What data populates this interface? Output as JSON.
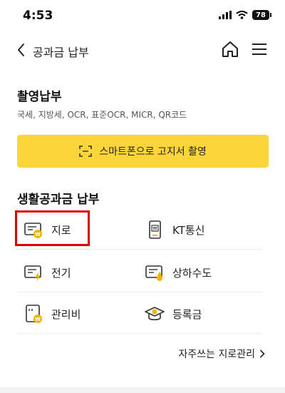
{
  "status": {
    "time": "4:53",
    "battery": "78"
  },
  "header": {
    "title": "공과금 납부"
  },
  "capture": {
    "title": "촬영납부",
    "subtitle": "국세, 지방세, OCR, 표준OCR, MICR, QR코드",
    "button_label": "스마트폰으로 고지서 촬영"
  },
  "living": {
    "title": "생활공과금 납부",
    "items": [
      {
        "label": "지로",
        "icon": "giro-bill-icon"
      },
      {
        "label": "KT통신",
        "icon": "kt-phone-icon"
      },
      {
        "label": "전기",
        "icon": "electricity-bill-icon"
      },
      {
        "label": "상하수도",
        "icon": "water-bill-icon"
      },
      {
        "label": "관리비",
        "icon": "maintenance-fee-icon"
      },
      {
        "label": "등록금",
        "icon": "tuition-icon"
      }
    ],
    "manage_link": "자주쓰는 지로관리"
  },
  "colors": {
    "accent": "#fcd53a",
    "highlight": "#e10000",
    "icon_gold": "#f0b400"
  }
}
